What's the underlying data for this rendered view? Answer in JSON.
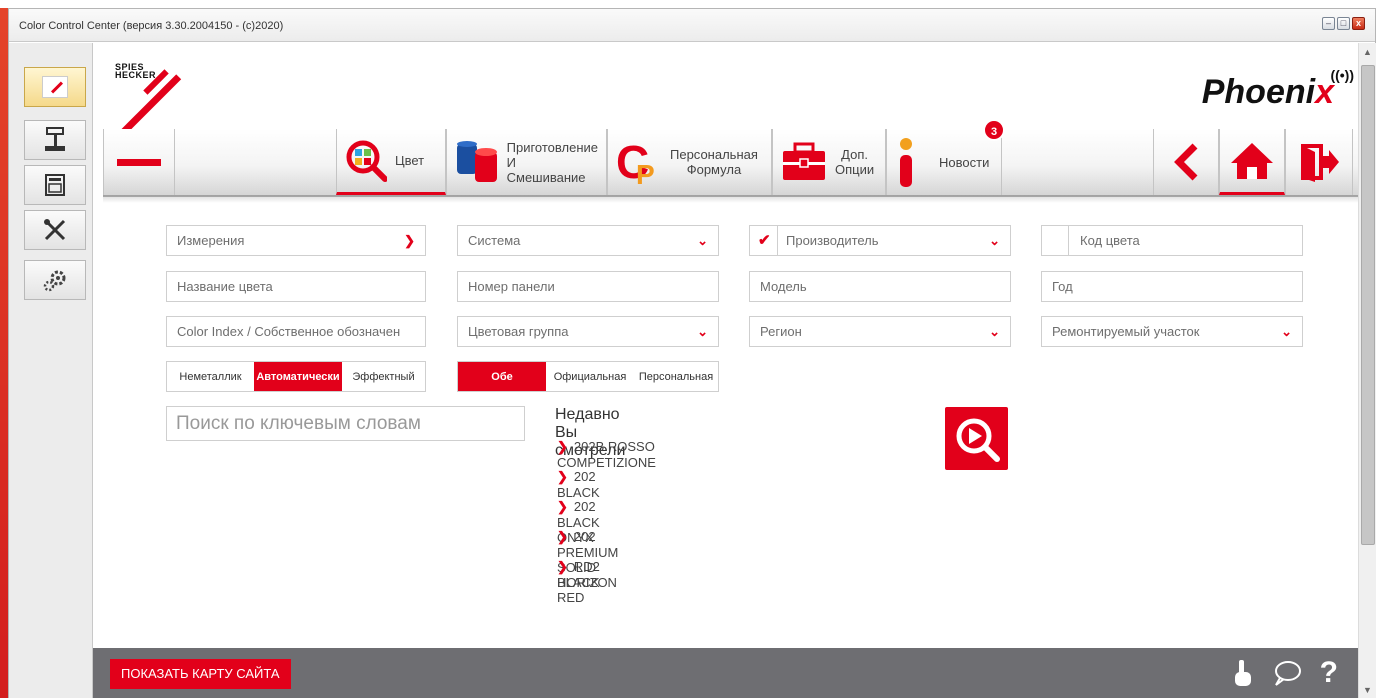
{
  "window": {
    "title": "Color Control Center (версия 3.30.2004150 - (c)2020)",
    "min": "–",
    "max": "□",
    "close": "x"
  },
  "brand": {
    "line1": "SPIES",
    "line2": "HECKER",
    "product_main": "Phoeni",
    "product_x": "x",
    "signal": "((•))"
  },
  "nav": {
    "color": "Цвет",
    "mixing_1": "Приготовление",
    "mixing_2": "И Смешивание",
    "personal_1": "Персональная",
    "personal_2": "Формула",
    "options_1": "Доп.",
    "options_2": "Опции",
    "news": "Новости",
    "news_badge": "3"
  },
  "form": {
    "measurements": "Измерения",
    "system": "Система",
    "manufacturer": "Производитель",
    "color_code": "Код цвета",
    "color_name": "Название цвета",
    "panel_number": "Номер панели",
    "model": "Модель",
    "year": "Год",
    "color_index": "Color Index / Собственное обозначен",
    "color_group": "Цветовая группа",
    "region": "Регион",
    "repair_area": "Ремонтируемый участок",
    "type_nonmetal": "Неметаллик",
    "type_auto": "Автоматически",
    "type_effect": "Эффектный",
    "src_both": "Обе",
    "src_official": "Официальная",
    "src_personal": "Персональная",
    "keyword_placeholder": "Поиск по ключевым словам"
  },
  "recent": {
    "title": "Недавно Вы смотрели",
    "items": [
      "202B ROSSO COMPETIZIONE",
      "202 BLACK",
      "202 BLACK ONYX",
      "202 PREMIUM SOLID BLACK",
      "RD2 HORIZON RED"
    ]
  },
  "footer": {
    "sitemap": "ПОКАЗАТЬ КАРТУ САЙТА",
    "help": "?"
  },
  "colors": {
    "accent": "#e2001a",
    "footer": "#6e6e72"
  }
}
